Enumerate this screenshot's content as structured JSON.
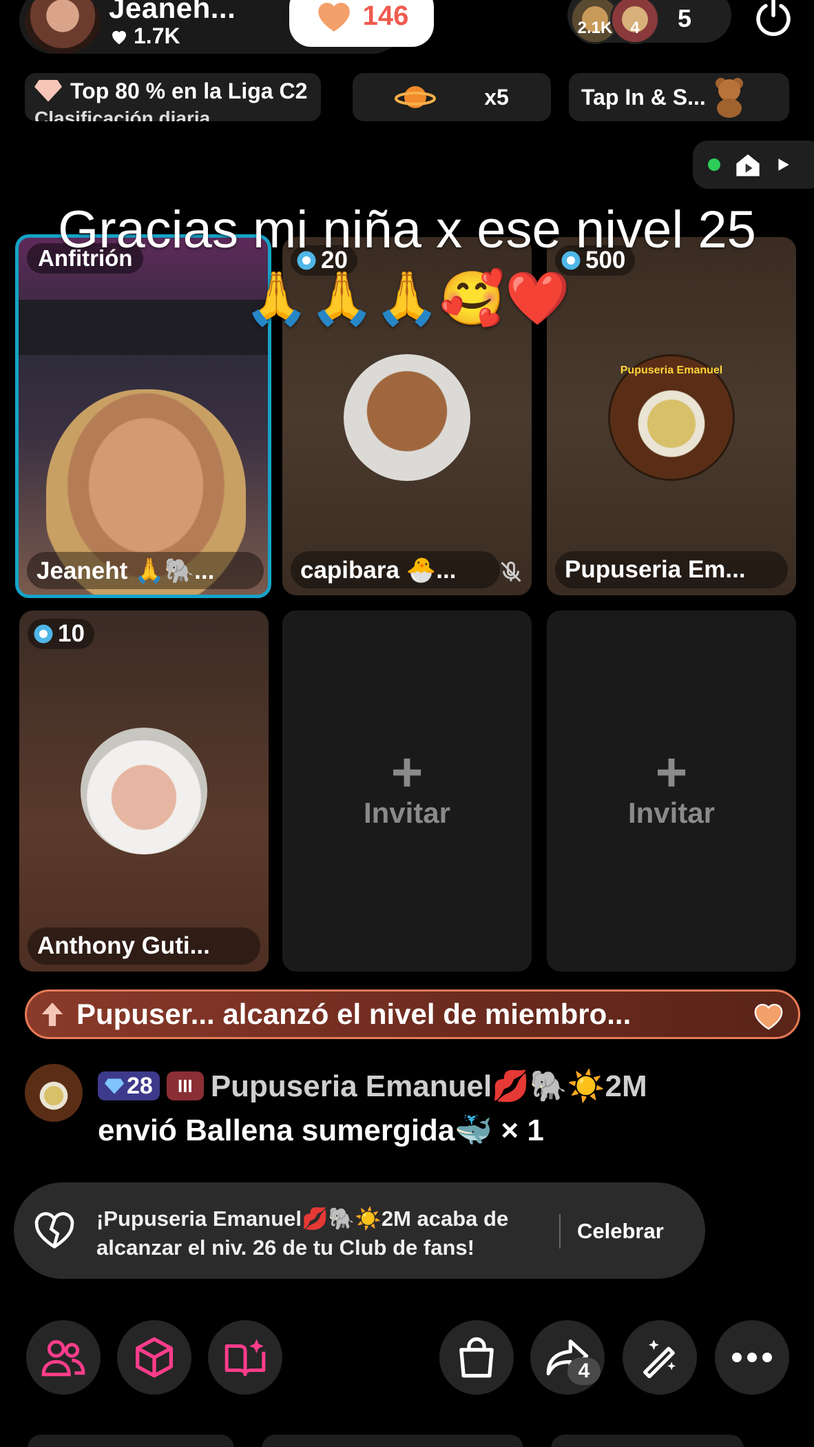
{
  "header": {
    "host_name": "Jeaneh...",
    "host_likes": "1.7K",
    "follow_count": "146",
    "viewer_badges": [
      "2.1K",
      "4"
    ],
    "viewer_count": "5"
  },
  "chips": {
    "league": "Top 80 % en la Liga C2",
    "league_sub": "Clasificación diaria",
    "multiplier": "x5",
    "tap": "Tap In & S..."
  },
  "overlay_text": "Gracias mi niña x ese nivel 25 🙏🙏🙏🥰❤️",
  "tiles": {
    "host": {
      "role": "Anfitrión",
      "name": "Jeaneht 🙏🐘..."
    },
    "guest1": {
      "level": "20",
      "name": "capibara 🐣..."
    },
    "guest2": {
      "level": "500",
      "name": "Pupuseria Em...",
      "logo_text": "Pupuseria Emanuel"
    },
    "guest3": {
      "level": "10",
      "name": "Anthony Guti..."
    },
    "empty_label": "Invitar",
    "empty_plus": "+"
  },
  "banner": {
    "text": "Pupuser... alcanzó el nivel de miembro..."
  },
  "chat": {
    "level": "28",
    "fan_badge": "III",
    "name": "Pupuseria Emanuel💋🐘☀️2M",
    "message": "envió Ballena sumergida🐳 × 1"
  },
  "toast": {
    "text": "¡Pupuseria Emanuel💋🐘☀️2M acaba de alcanzar el niv. 26 de tu Club de fans!",
    "button": "Celebrar"
  },
  "bottom_bar": {
    "share_count": "4"
  },
  "colors": {
    "host_border": "#16a3c7",
    "follow_count": "#f05a4f",
    "banner_border": "#e77b57",
    "icon_pink": "#ff3d8b"
  }
}
